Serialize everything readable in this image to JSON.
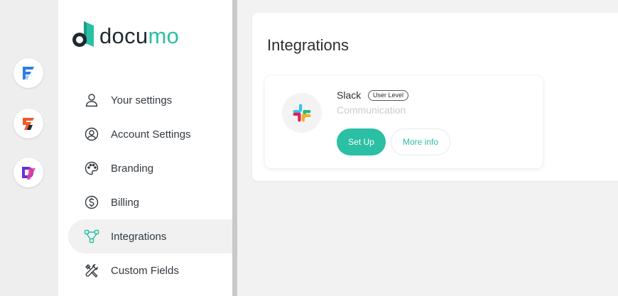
{
  "brand": {
    "name_prefix": "docu",
    "name_highlight": "mo",
    "accent": "#2bbfa4"
  },
  "apps": [
    {
      "icon": "app-f-icon"
    },
    {
      "icon": "app-s-icon"
    },
    {
      "icon": "app-d-icon"
    }
  ],
  "sidebar": {
    "items": [
      {
        "label": "Your settings",
        "icon": "user-icon"
      },
      {
        "label": "Account Settings",
        "icon": "account-circle-icon"
      },
      {
        "label": "Branding",
        "icon": "palette-icon"
      },
      {
        "label": "Billing",
        "icon": "dollar-circle-icon"
      },
      {
        "label": "Integrations",
        "icon": "integrations-icon",
        "active": true
      },
      {
        "label": "Custom Fields",
        "icon": "tools-icon"
      }
    ]
  },
  "main": {
    "title": "Integrations",
    "integrations": [
      {
        "name": "Slack",
        "badge": "User Level",
        "category": "Communication",
        "icon": "slack-icon",
        "setup_label": "Set Up",
        "more_label": "More info"
      }
    ]
  }
}
